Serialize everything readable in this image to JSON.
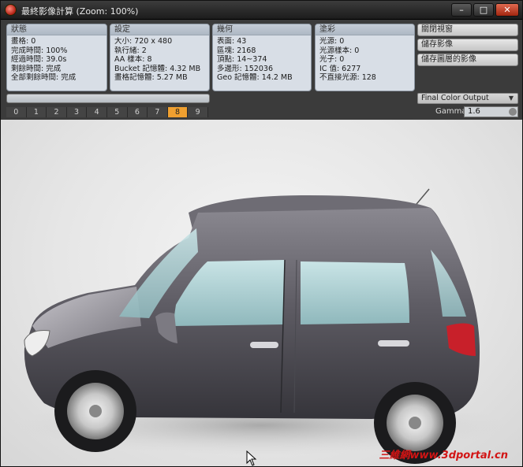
{
  "window": {
    "title": "最終影像計算 (Zoom: 100%)",
    "controls": {
      "minimize": "–",
      "maximize": "□",
      "close": "✕"
    }
  },
  "panels": {
    "status": {
      "title": "狀態",
      "rows": [
        "畫格: 0",
        "完成時間: 100%",
        "經過時間: 39.0s",
        "剩餘時間: 完成",
        "全部剩餘時間: 完成"
      ]
    },
    "settings": {
      "title": "設定",
      "rows": [
        "大小: 720 x 480",
        "執行緒: 2",
        "AA 樣本: 8",
        "Bucket 記憶體: 4.32 MB",
        "畫格記憶體: 5.27 MB"
      ]
    },
    "geometry": {
      "title": "幾何",
      "rows": [
        "表面: 43",
        "區塊: 2168",
        "頂點: 14~374",
        "多邊形: 152036",
        "Geo 記憶體: 14.2 MB"
      ]
    },
    "shading": {
      "title": "塗彩",
      "rows": [
        "光源: 0",
        "光源樣本: 0",
        "光子: 0",
        "IC 值: 6277",
        "不直接光源: 128"
      ]
    }
  },
  "side_buttons": [
    "關閉視窗",
    "儲存影像",
    "儲存圖層的影像"
  ],
  "output_select": {
    "selected": "Final Color Output"
  },
  "gamma": {
    "label": "Gamma",
    "value": "1.6"
  },
  "buffer_slots": {
    "labels": [
      "0",
      "1",
      "2",
      "3",
      "4",
      "5",
      "6",
      "7",
      "8",
      "9"
    ],
    "active_index": 8
  },
  "render": {
    "subject": "rendered car",
    "watermark": "三維網www.3dportal.cn"
  },
  "colors": {
    "active_slot": "#f0a030",
    "close_button": "#c0391c",
    "panel_bg": "#d8dee6"
  }
}
